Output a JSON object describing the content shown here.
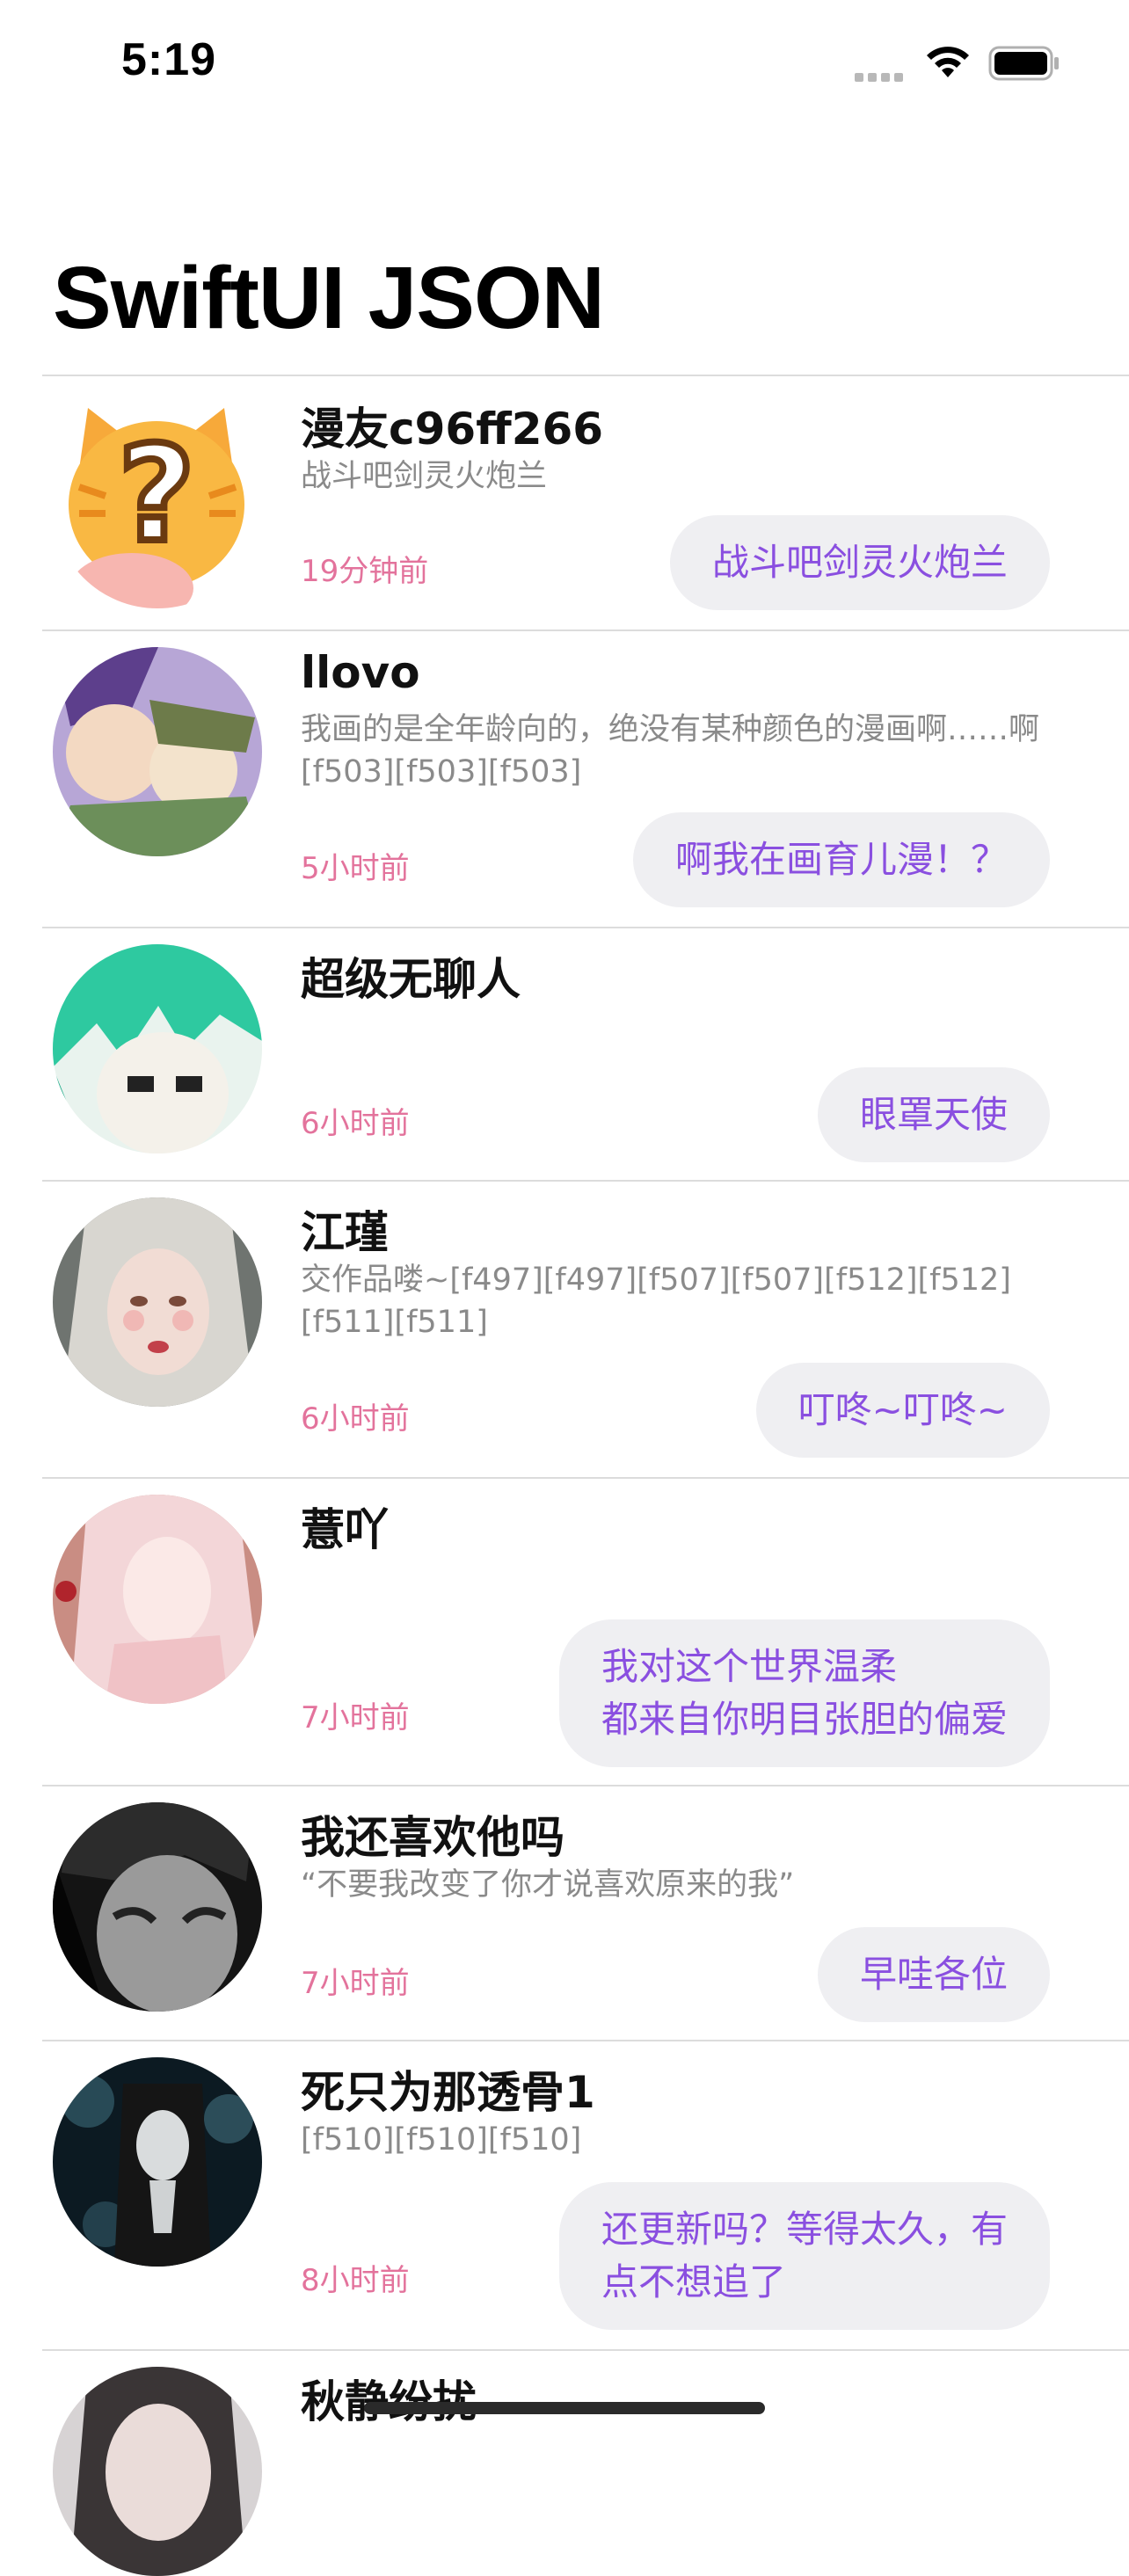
{
  "status_bar": {
    "time": "5:19"
  },
  "nav": {
    "title": "SwiftUI JSON"
  },
  "feed": [
    {
      "name": "漫友c96ff266",
      "message": "战斗吧剑灵火炮兰",
      "time": "19分钟前",
      "reply": "战斗吧剑灵火炮兰"
    },
    {
      "name": "llovo",
      "message": "我画的是全年龄向的，绝没有某种颜色的漫画啊……啊[f503][f503][f503]",
      "time": "5小时前",
      "reply": "啊我在画育儿漫！？"
    },
    {
      "name": "超级无聊人",
      "message": "",
      "time": "6小时前",
      "reply": "眼罩天使"
    },
    {
      "name": "江瑾",
      "message": "交作品喽~[f497][f497][f507][f507][f512][f512][f511][f511]",
      "time": "6小时前",
      "reply": "叮咚~叮咚~"
    },
    {
      "name": "薏吖",
      "message": "",
      "time": "7小时前",
      "reply": "我对这个世界温柔\n都来自你明目张胆的偏爱"
    },
    {
      "name": "我还喜欢他吗",
      "message": "“不要我改变了你才说喜欢原来的我”",
      "time": "7小时前",
      "reply": "早哇各位"
    },
    {
      "name": "死只为那透骨1",
      "message": "[f510][f510][f510]",
      "time": "8小时前",
      "reply": "还更新吗？等得太久，有\n点不想追了"
    },
    {
      "name": "秋静纷扰",
      "message": "",
      "time": "",
      "reply": ""
    }
  ]
}
